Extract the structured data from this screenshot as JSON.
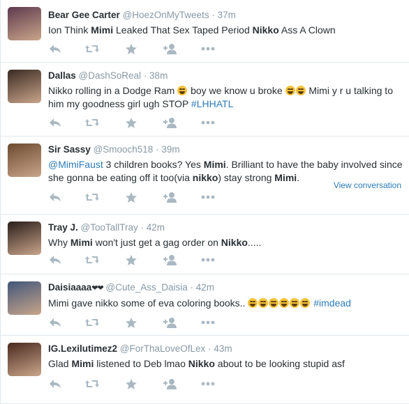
{
  "tweets": [
    {
      "fullname": "Bear Gee Carter",
      "username": "@HoezOnMyTweets",
      "time": "37m",
      "avatar_color": "#5e3a4e",
      "text_parts": [
        {
          "t": "Ion Think "
        },
        {
          "t": "Mimi",
          "b": true
        },
        {
          "t": " Leaked That Sex Taped Period "
        },
        {
          "t": "Nikko",
          "b": true
        },
        {
          "t": " Ass A Clown"
        }
      ]
    },
    {
      "fullname": "Dallas",
      "username": "@DashSoReal",
      "time": "38m",
      "avatar_color": "#3a2a22",
      "text_parts": [
        {
          "t": "Nikko rolling in a Dodge Ram "
        },
        {
          "emoji": 1
        },
        {
          "t": " boy we know u broke "
        },
        {
          "emoji": 2
        },
        {
          "t": " Mimi y r u talking to him my goodness girl ugh STOP "
        },
        {
          "t": "#LHHATL",
          "c": "hash"
        }
      ]
    },
    {
      "fullname": "Sir Sassy",
      "username": "@Smooch518",
      "time": "39m",
      "avatar_color": "#6b4b2f",
      "text_parts": [
        {
          "t": "@MimiFaust",
          "c": "mention"
        },
        {
          "t": " 3 children books? Yes "
        },
        {
          "t": "Mimi",
          "b": true
        },
        {
          "t": ". Brilliant to have the baby involved since she gonna be eating off it too(via "
        },
        {
          "t": "nikko",
          "b": true
        },
        {
          "t": ") stay strong "
        },
        {
          "t": "Mimi",
          "b": true
        },
        {
          "t": "."
        }
      ],
      "view_conversation": "View conversation"
    },
    {
      "fullname": "Tray J.",
      "username": "@TooTallTray",
      "time": "42m",
      "avatar_color": "#2a1d1a",
      "text_parts": [
        {
          "t": "Why "
        },
        {
          "t": "Mimi",
          "b": true
        },
        {
          "t": " won't just get a gag order on "
        },
        {
          "t": "Nikko",
          "b": true
        },
        {
          "t": "....."
        }
      ]
    },
    {
      "fullname": "Daisiaaaa",
      "fullname_suffix": "❤❤",
      "username": "@Cute_Ass_Daisia",
      "time": "42m",
      "avatar_color": "#41567a",
      "text_parts": [
        {
          "t": "Mimi gave nikko some of eva coloring books..  "
        },
        {
          "emoji": 6
        },
        {
          "t": " "
        },
        {
          "t": "#imdead",
          "c": "hash"
        }
      ]
    },
    {
      "fullname": "IG.Lexilutimez2",
      "username": "@ForThaLoveOfLex",
      "time": "43m",
      "avatar_color": "#4a2a20",
      "text_parts": [
        {
          "t": "Glad "
        },
        {
          "t": "Mimi",
          "b": true
        },
        {
          "t": " listened to Deb lmao "
        },
        {
          "t": "Nikko",
          "b": true
        },
        {
          "t": " about to be looking stupid asf"
        }
      ]
    }
  ],
  "colors": {
    "link": "#2b7bb9",
    "muted": "#8899a6",
    "text": "#292f33",
    "action_icon": "#aab8c2",
    "divider": "#e1e8ed"
  },
  "action_icons": [
    "reply-icon",
    "retweet-icon",
    "favorite-icon",
    "follow-icon",
    "more-icon"
  ]
}
